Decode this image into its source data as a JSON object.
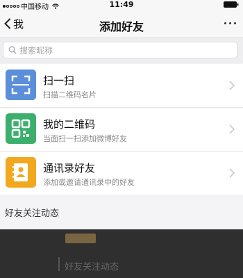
{
  "status_bar": {
    "carrier": "中国移动",
    "time": "11:49",
    "icons": [
      "signal-dots",
      "wifi-icon",
      "battery-icon"
    ]
  },
  "nav": {
    "back_label": "我",
    "title": "添加好友",
    "more_icon": "more-dots-icon"
  },
  "search": {
    "placeholder": "搜索昵称",
    "icon": "search-icon"
  },
  "items": [
    {
      "title": "扫一扫",
      "subtitle": "扫描二维码名片",
      "icon": "scan-icon",
      "icon_color": "#5b8fd9"
    },
    {
      "title": "我的二维码",
      "subtitle": "当面扫一扫添加微博好友",
      "icon": "qr-code-icon",
      "icon_color": "#3daf6c"
    },
    {
      "title": "通讯录好友",
      "subtitle": "添加或邀请通讯录中的好友",
      "icon": "contacts-icon",
      "icon_color": "#f2a81e"
    }
  ],
  "section": {
    "header": "好友关注动态"
  },
  "overlay": {
    "caption": "好友关注动态"
  }
}
